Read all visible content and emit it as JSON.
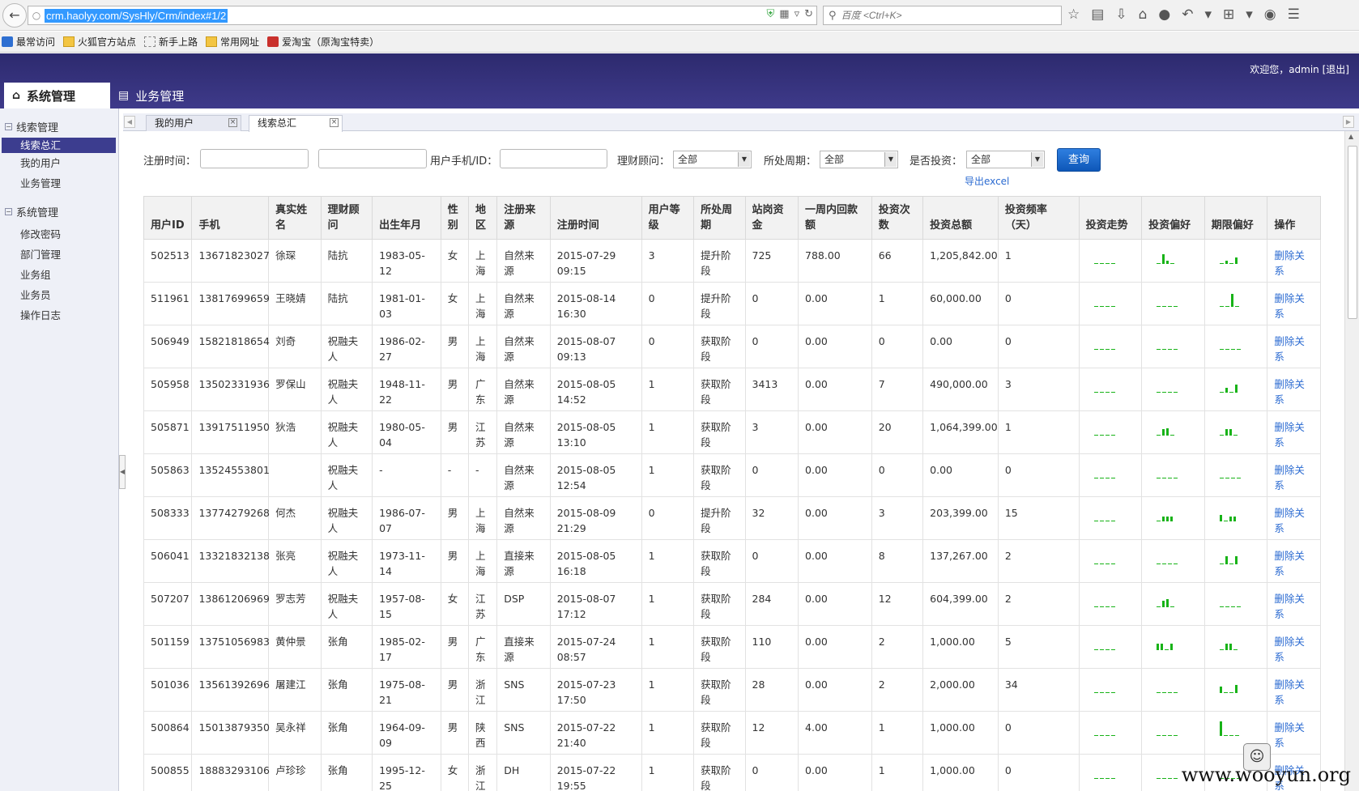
{
  "browser": {
    "url": "crm.haolyy.com/SysHly/Crm/index#1/2",
    "search_placeholder": "百度 <Ctrl+K>"
  },
  "bookmarks": [
    "最常访问",
    "火狐官方站点",
    "新手上路",
    "常用网址",
    "爱淘宝（原淘宝特卖）"
  ],
  "header": {
    "welcome": "欢迎您，admin",
    "logout": "[退出]",
    "tabs": [
      "系统管理",
      "业务管理"
    ]
  },
  "sidebar": {
    "group1": "线索管理",
    "group1_items": [
      "线索总汇",
      "我的用户",
      "业务管理"
    ],
    "group2": "系统管理",
    "group2_items": [
      "修改密码",
      "部门管理",
      "业务组",
      "业务员",
      "操作日志"
    ]
  },
  "content_tabs": [
    "我的用户",
    "线索总汇"
  ],
  "filters": {
    "reg_time": "注册时间：",
    "user_phone": "用户手机/ID：",
    "advisor": "理财顾问：",
    "advisor_value": "全部",
    "cycle": "所处周期：",
    "cycle_value": "全部",
    "invested": "是否投资：",
    "invested_value": "全部",
    "query": "查询",
    "export": "导出excel"
  },
  "table": {
    "headers": [
      "用户ID",
      "手机",
      "真实姓名",
      "理财顾问",
      "出生年月",
      "性别",
      "地区",
      "注册来源",
      "注册时间",
      "用户等级",
      "所处周期",
      "站岗资金",
      "一周内回款额",
      "投资次数",
      "投资总额",
      "投资频率（天）",
      "投资走势",
      "投资偏好",
      "期限偏好",
      "操作"
    ],
    "rows": [
      [
        "502513",
        "13671823027",
        "徐琛",
        "陆抗",
        "1983-05-12",
        "女",
        "上海",
        "自然来源",
        "2015-07-29 09:15",
        "3",
        "提升阶段",
        "725",
        "788.00",
        "66",
        "1,205,842.00",
        "1",
        "",
        "",
        "",
        "删除关系"
      ],
      [
        "511961",
        "13817699659",
        "王晓婧",
        "陆抗",
        "1981-01-03",
        "女",
        "上海",
        "自然来源",
        "2015-08-14 16:30",
        "0",
        "提升阶段",
        "0",
        "0.00",
        "1",
        "60,000.00",
        "0",
        "",
        "",
        "",
        "删除关系"
      ],
      [
        "506949",
        "15821818654",
        "刘奇",
        "祝融夫人",
        "1986-02-27",
        "男",
        "上海",
        "自然来源",
        "2015-08-07 09:13",
        "0",
        "获取阶段",
        "0",
        "0.00",
        "0",
        "0.00",
        "0",
        "",
        "",
        "",
        "删除关系"
      ],
      [
        "505958",
        "13502331936",
        "罗保山",
        "祝融夫人",
        "1948-11-22",
        "男",
        "广东",
        "自然来源",
        "2015-08-05 14:52",
        "1",
        "获取阶段",
        "3413",
        "0.00",
        "7",
        "490,000.00",
        "3",
        "",
        "",
        "",
        "删除关系"
      ],
      [
        "505871",
        "13917511950",
        "狄浩",
        "祝融夫人",
        "1980-05-04",
        "男",
        "江苏",
        "自然来源",
        "2015-08-05 13:10",
        "1",
        "获取阶段",
        "3",
        "0.00",
        "20",
        "1,064,399.00",
        "1",
        "",
        "",
        "",
        "删除关系"
      ],
      [
        "505863",
        "13524553801",
        "",
        "祝融夫人",
        "-",
        "-",
        "-",
        "自然来源",
        "2015-08-05 12:54",
        "1",
        "获取阶段",
        "0",
        "0.00",
        "0",
        "0.00",
        "0",
        "",
        "",
        "",
        "删除关系"
      ],
      [
        "508333",
        "13774279268",
        "何杰",
        "祝融夫人",
        "1986-07-07",
        "男",
        "上海",
        "自然来源",
        "2015-08-09 21:29",
        "0",
        "提升阶段",
        "32",
        "0.00",
        "3",
        "203,399.00",
        "15",
        "",
        "",
        "",
        "删除关系"
      ],
      [
        "506041",
        "13321832138",
        "张亮",
        "祝融夫人",
        "1973-11-14",
        "男",
        "上海",
        "直接来源",
        "2015-08-05 16:18",
        "1",
        "获取阶段",
        "0",
        "0.00",
        "8",
        "137,267.00",
        "2",
        "",
        "",
        "",
        "删除关系"
      ],
      [
        "507207",
        "13861206969",
        "罗志芳",
        "祝融夫人",
        "1957-08-15",
        "女",
        "江苏",
        "DSP",
        "2015-08-07 17:12",
        "1",
        "获取阶段",
        "284",
        "0.00",
        "12",
        "604,399.00",
        "2",
        "",
        "",
        "",
        "删除关系"
      ],
      [
        "501159",
        "13751056983",
        "黄仲景",
        "张角",
        "1985-02-17",
        "男",
        "广东",
        "直接来源",
        "2015-07-24 08:57",
        "1",
        "获取阶段",
        "110",
        "0.00",
        "2",
        "1,000.00",
        "5",
        "",
        "",
        "",
        "删除关系"
      ],
      [
        "501036",
        "13561392696",
        "屠建江",
        "张角",
        "1975-08-21",
        "男",
        "浙江",
        "SNS",
        "2015-07-23 17:50",
        "1",
        "获取阶段",
        "28",
        "0.00",
        "2",
        "2,000.00",
        "34",
        "",
        "",
        "",
        "删除关系"
      ],
      [
        "500864",
        "15013879350",
        "吴永祥",
        "张角",
        "1964-09-09",
        "男",
        "陕西",
        "SNS",
        "2015-07-22 21:40",
        "1",
        "获取阶段",
        "12",
        "4.00",
        "1",
        "1,000.00",
        "0",
        "",
        "",
        "",
        "删除关系"
      ],
      [
        "500855",
        "18883293106",
        "卢珍珍",
        "张角",
        "1995-12-25",
        "女",
        "浙江",
        "DH",
        "2015-07-22 19:55",
        "1",
        "获取阶段",
        "0",
        "0.00",
        "1",
        "1,000.00",
        "0",
        "",
        "",
        "",
        "删除关系"
      ]
    ],
    "spark_invest_pref": [
      [
        0,
        12,
        4,
        0
      ],
      [
        0,
        0,
        0,
        0
      ],
      [
        0,
        0,
        0,
        0
      ],
      [
        0,
        0,
        0,
        0
      ],
      [
        0,
        8,
        9,
        0
      ],
      [
        0,
        0,
        0,
        0
      ],
      [
        0,
        6,
        6,
        6
      ],
      [
        0,
        0,
        0,
        0
      ],
      [
        0,
        8,
        10,
        0
      ],
      [
        8,
        8,
        0,
        8
      ],
      [
        0,
        0,
        0,
        0
      ],
      [
        0,
        0,
        0,
        0
      ],
      [
        0,
        0,
        0,
        0
      ]
    ],
    "spark_term_pref": [
      [
        0,
        4,
        0,
        8
      ],
      [
        0,
        0,
        16,
        0
      ],
      [
        0,
        0,
        0,
        0
      ],
      [
        0,
        6,
        0,
        10
      ],
      [
        0,
        8,
        8,
        0
      ],
      [
        0,
        0,
        0,
        0
      ],
      [
        8,
        0,
        6,
        6
      ],
      [
        0,
        10,
        0,
        10
      ],
      [
        0,
        0,
        0,
        0
      ],
      [
        0,
        8,
        8,
        0
      ],
      [
        8,
        0,
        0,
        10
      ],
      [
        18,
        0,
        0,
        0
      ],
      [
        0,
        0,
        0,
        0
      ]
    ]
  },
  "watermark": "www.wooyun.org"
}
